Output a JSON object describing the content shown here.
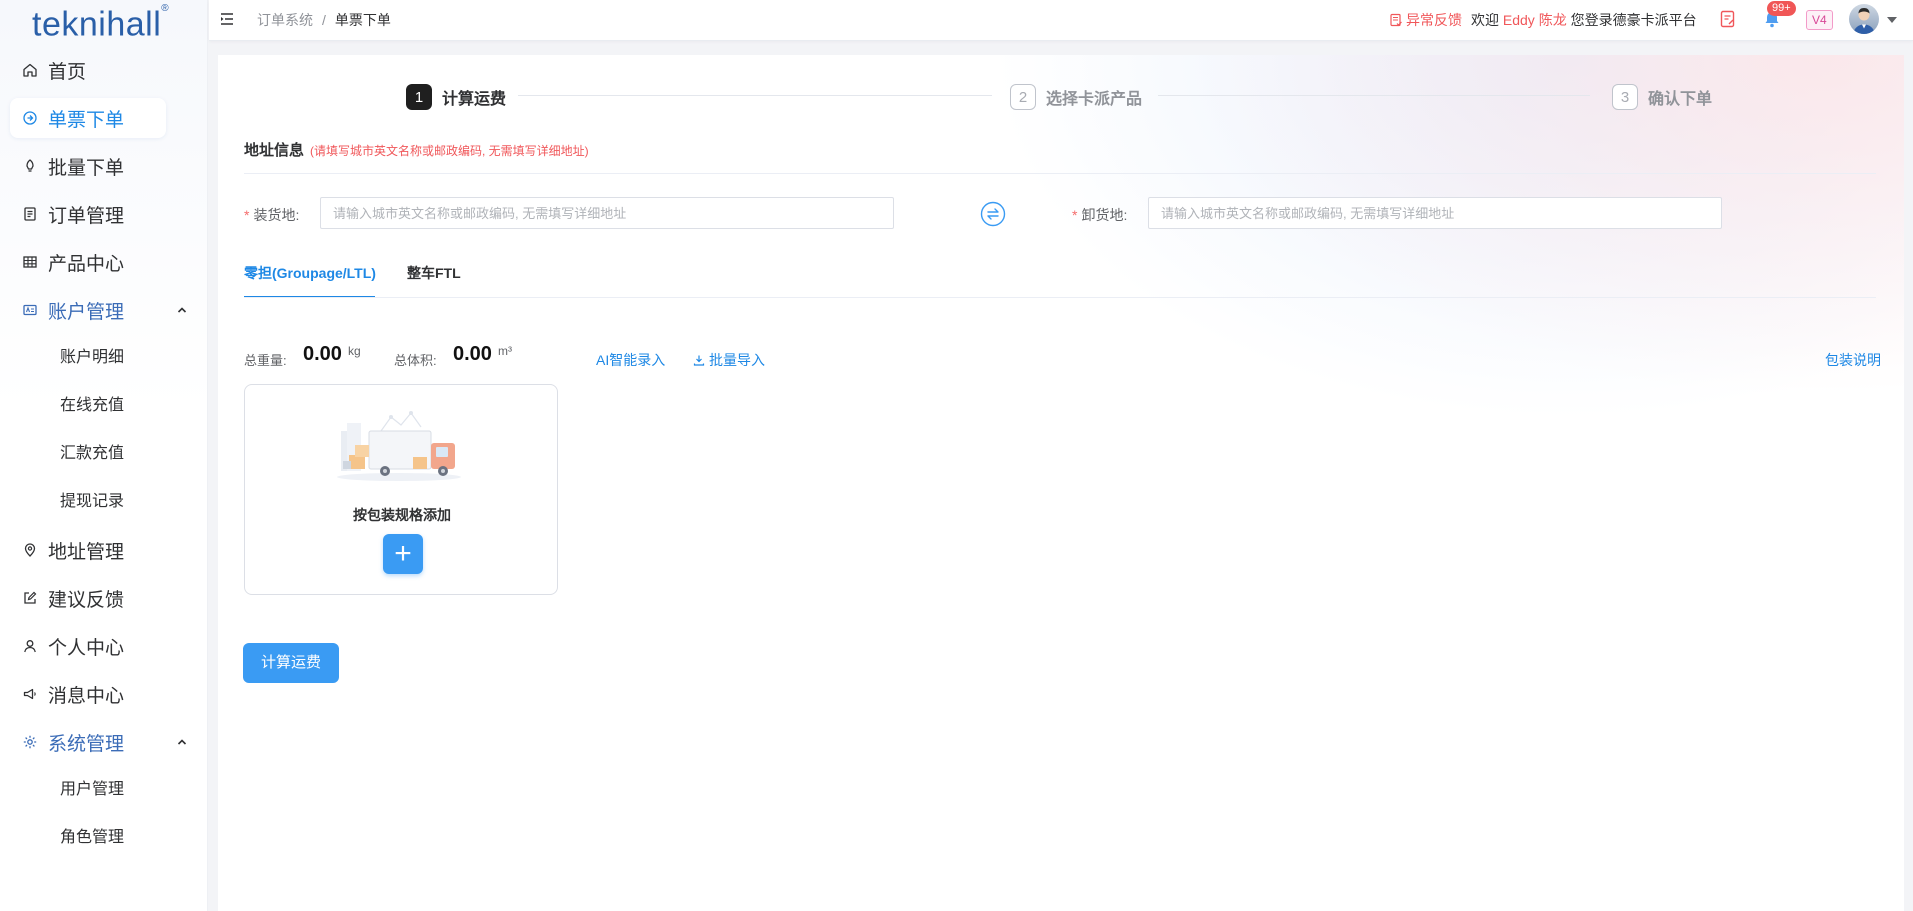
{
  "app": {
    "logo_text": "teknihall",
    "logo_mark": "®"
  },
  "sidebar": {
    "items": [
      {
        "label": "首页",
        "icon": "home-icon"
      },
      {
        "label": "单票下单",
        "icon": "order-icon",
        "active": true
      },
      {
        "label": "批量下单",
        "icon": "rocket-icon"
      },
      {
        "label": "订单管理",
        "icon": "document-icon"
      },
      {
        "label": "产品中心",
        "icon": "grid-icon"
      },
      {
        "label": "账户管理",
        "icon": "account-card-icon",
        "expanded": true,
        "children": [
          "账户明细",
          "在线充值",
          "汇款充值",
          "提现记录"
        ]
      },
      {
        "label": "地址管理",
        "icon": "location-pin-icon"
      },
      {
        "label": "建议反馈",
        "icon": "edit-icon"
      },
      {
        "label": "个人中心",
        "icon": "user-icon"
      },
      {
        "label": "消息中心",
        "icon": "megaphone-icon"
      },
      {
        "label": "系统管理",
        "icon": "gear-icon",
        "expanded": true,
        "children": [
          "用户管理",
          "角色管理"
        ]
      }
    ]
  },
  "header": {
    "breadcrumb": [
      "订单系统",
      "单票下单"
    ],
    "breadcrumb_sep": "/",
    "feedback_label": "异常反馈",
    "welcome_prefix": "欢迎",
    "user_name": "Eddy 陈龙",
    "welcome_suffix": "您登录德豪卡派平台",
    "notification_count": "99+",
    "version_tag": "V4",
    "colors": {
      "alert": "#f0575a",
      "accent": "#1e88e5"
    }
  },
  "steps": [
    {
      "num": "1",
      "label": "计算运费",
      "state": "active"
    },
    {
      "num": "2",
      "label": "选择卡派产品",
      "state": "todo"
    },
    {
      "num": "3",
      "label": "确认下单",
      "state": "todo"
    }
  ],
  "address": {
    "title": "地址信息",
    "hint": "(请填写城市英文名称或邮政编码, 无需填写详细地址)",
    "required_mark": "*",
    "loading_label": "装货地:",
    "loading_placeholder": "请输入城市英文名称或邮政编码, 无需填写详细地址",
    "loading_value": "",
    "unloading_label": "卸货地:",
    "unloading_placeholder": "请输入城市英文名称或邮政编码, 无需填写详细地址",
    "unloading_value": ""
  },
  "tabs": [
    {
      "label": "零担(Groupage/LTL)",
      "active": true
    },
    {
      "label": "整车FTL",
      "active": false
    }
  ],
  "cargo": {
    "weight_label": "总重量:",
    "weight_value": "0.00",
    "weight_unit": "kg",
    "volume_label": "总体积:",
    "volume_value": "0.00",
    "volume_unit": "m³",
    "ai_entry": "AI智能录入",
    "batch_import": "批量导入",
    "packing_note": "包装说明",
    "add_by_spec": "按包装规格添加",
    "add_symbol": "+"
  },
  "actions": {
    "calculate": "计算运费"
  }
}
